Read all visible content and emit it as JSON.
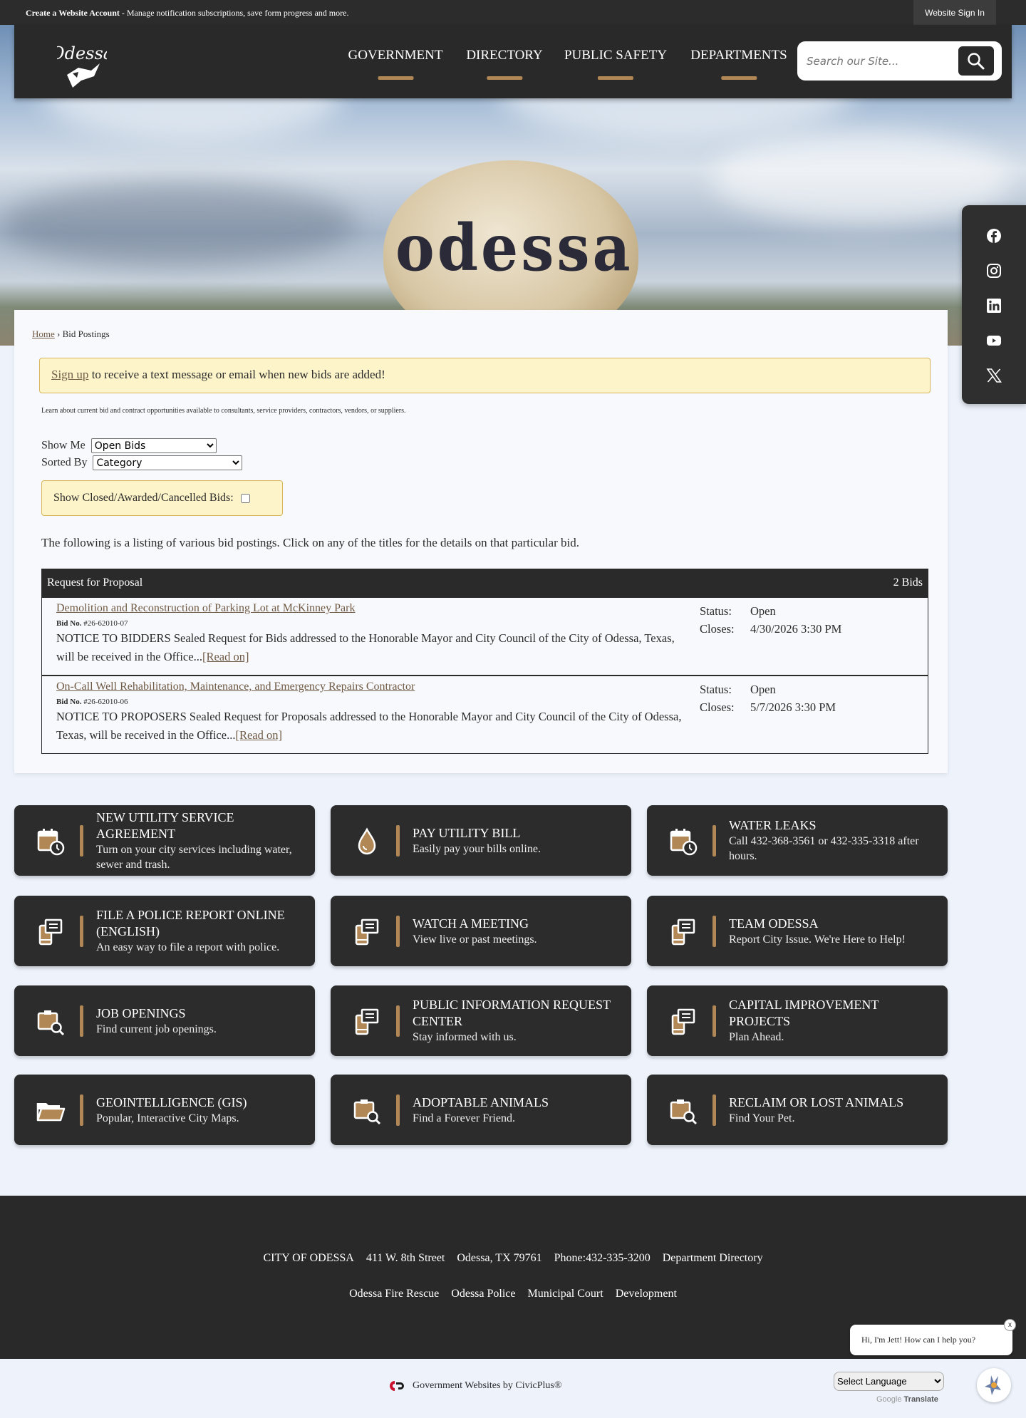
{
  "topbar": {
    "account_bold": "Create a Website Account",
    "account_rest": " - Manage notification subscriptions, save form progress and more.",
    "sign_in": "Website Sign In"
  },
  "header": {
    "logo_text": "Odessa",
    "nav": [
      "GOVERNMENT",
      "DIRECTORY",
      "PUBLIC SAFETY",
      "DEPARTMENTS"
    ],
    "search_placeholder": "Search our Site..."
  },
  "hero": {
    "tower_text": "odessa"
  },
  "social": [
    "facebook",
    "instagram",
    "linkedin",
    "youtube",
    "x"
  ],
  "breadcrumb": {
    "home": "Home",
    "sep": " › ",
    "current": "Bid Postings"
  },
  "alert": {
    "link": "Sign up",
    "text": " to receive a text message or email when new bids are added!"
  },
  "description": "Learn about current bid and contract opportunities available to consultants, service providers, contractors, vendors, or suppliers.",
  "filters": {
    "show_me_label": "Show Me",
    "show_me_value": "Open Bids",
    "sorted_by_label": "Sorted By",
    "sorted_by_value": "Category",
    "closed_label": "Show Closed/Awarded/Cancelled Bids:",
    "closed_checked": false
  },
  "listing_intro": "The following is a listing of various bid postings. Click on any of the titles for the details on that particular bid.",
  "bids": {
    "category": "Request for Proposal",
    "count": "2 Bids",
    "items": [
      {
        "title": "Demolition and Reconstruction of Parking Lot at McKinney Park",
        "bid_no_label": "Bid No.",
        "bid_no": "#26-62010-07",
        "body": "NOTICE TO BIDDERS Sealed Request for Bids addressed to the Honorable Mayor and City Council of the City of Odessa, Texas, will be received in the Office...",
        "read_on": "[Read on]",
        "status_label": "Status:",
        "status": "Open",
        "closes_label": "Closes:",
        "closes": "4/30/2026 3:30 PM"
      },
      {
        "title": "On-Call Well Rehabilitation, Maintenance, and Emergency Repairs Contractor",
        "bid_no_label": "Bid No.",
        "bid_no": "#26-62010-06",
        "body": "NOTICE TO PROPOSERS Sealed Request for Proposals addressed to the Honorable Mayor and City Council of the City of Odessa, Texas, will be received in the Office...",
        "read_on": "[Read on]",
        "status_label": "Status:",
        "status": "Open",
        "closes_label": "Closes:",
        "closes": "5/7/2026 3:30 PM"
      }
    ]
  },
  "tiles": [
    {
      "title": "NEW UTILITY SERVICE AGREEMENT",
      "desc": "Turn on your city services including water, sewer and trash.",
      "icon": "calendar-clock"
    },
    {
      "title": "PAY UTILITY BILL",
      "desc": "Easily pay your bills online.",
      "icon": "water-drop"
    },
    {
      "title": "WATER LEAKS",
      "desc": "Call 432-368-3561 or 432-335-3318 after hours.",
      "icon": "calendar-clock"
    },
    {
      "title": "FILE A POLICE REPORT ONLINE (ENGLISH)",
      "desc": "An easy way to file a report with police.",
      "icon": "document-phone"
    },
    {
      "title": "WATCH A MEETING",
      "desc": "View live or past meetings.",
      "icon": "document-phone"
    },
    {
      "title": "TEAM ODESSA",
      "desc": "Report City Issue. We're Here to Help!",
      "icon": "document-phone"
    },
    {
      "title": "JOB OPENINGS",
      "desc": "Find current job openings.",
      "icon": "clipboard-search"
    },
    {
      "title": "PUBLIC INFORMATION REQUEST CENTER",
      "desc": "Stay informed with us.",
      "icon": "document-phone"
    },
    {
      "title": "CAPITAL IMPROVEMENT PROJECTS",
      "desc": "Plan Ahead.",
      "icon": "document-phone"
    },
    {
      "title": "GEOINTELLIGENCE (GIS)",
      "desc": "Popular, Interactive City Maps.",
      "icon": "folder-open"
    },
    {
      "title": "ADOPTABLE ANIMALS",
      "desc": "Find a Forever Friend.",
      "icon": "clipboard-search"
    },
    {
      "title": "RECLAIM OR LOST ANIMALS",
      "desc": "Find Your Pet.",
      "icon": "clipboard-search"
    }
  ],
  "footer": {
    "row1": [
      "CITY OF ODESSA",
      "411 W. 8th Street",
      "Odessa, TX 79761",
      "Phone:432-335-3200",
      "Department Directory"
    ],
    "row2": [
      "Odessa Fire Rescue",
      "Odessa Police",
      "Municipal Court",
      "Development"
    ],
    "civicplus": "Government Websites by CivicPlus®",
    "language": "Select Language",
    "google": "Google",
    "translate": "Translate"
  },
  "chat": {
    "message": "Hi, I'm Jett! How can I help you?",
    "close": "x"
  },
  "colors": {
    "accent": "#b08755",
    "dark": "#2a2929",
    "alert_bg": "#fdf5c9",
    "link": "#6f5a45"
  }
}
